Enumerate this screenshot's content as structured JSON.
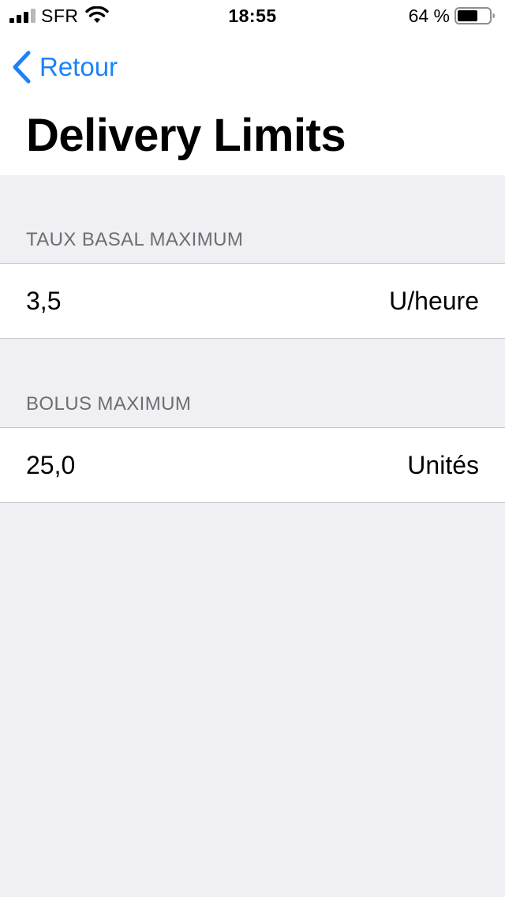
{
  "status_bar": {
    "carrier": "SFR",
    "time": "18:55",
    "battery_percent": "64 %",
    "battery_level": 0.64,
    "signal_icon": "cellular-signal-icon",
    "wifi_icon": "wifi-icon",
    "battery_icon": "battery-icon"
  },
  "nav": {
    "back_label": "Retour",
    "back_icon": "chevron-left-icon",
    "title": "Delivery Limits"
  },
  "sections": [
    {
      "header": "TAUX BASAL MAXIMUM",
      "value": "3,5",
      "unit": "U/heure"
    },
    {
      "header": "BOLUS MAXIMUM",
      "value": "25,0",
      "unit": "Unités"
    }
  ],
  "colors": {
    "accent": "#1a82fb",
    "background": "#efeff4",
    "header_text": "#6d6d72",
    "separator": "#c8c7cc"
  }
}
